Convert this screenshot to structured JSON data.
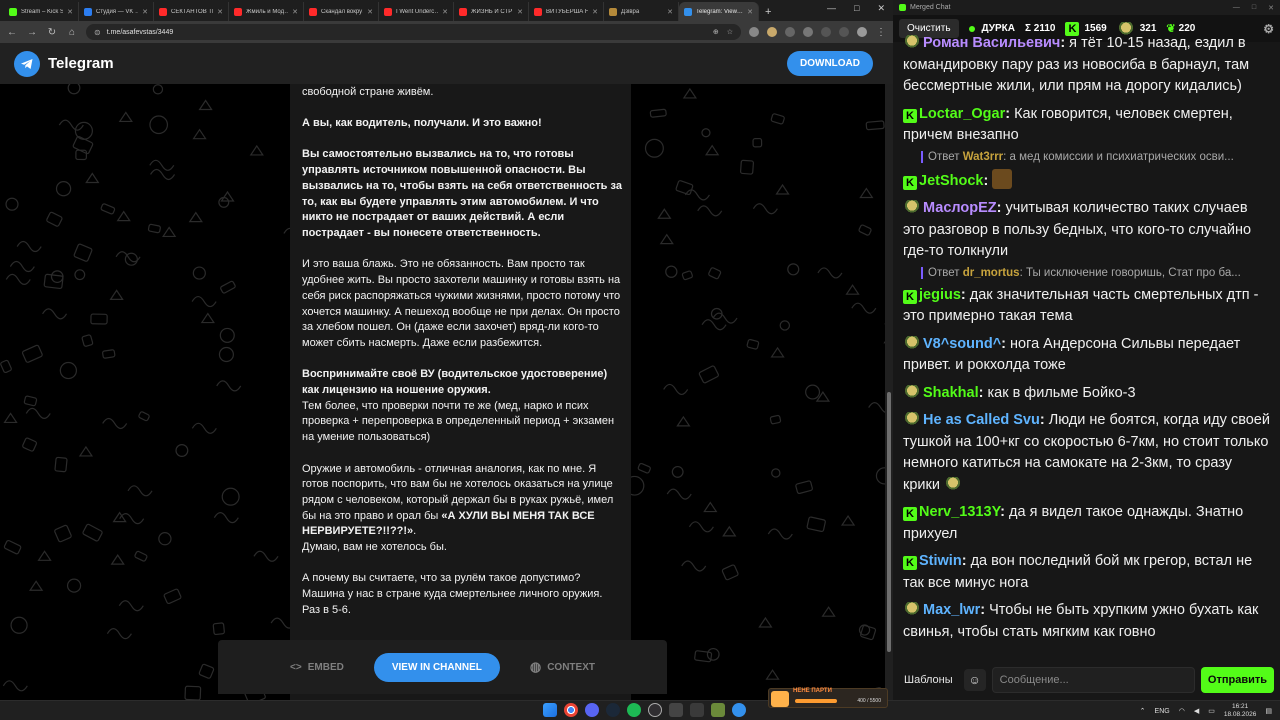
{
  "browser": {
    "tabs": [
      {
        "title": "Stream – Kick S…",
        "color": "#53fc18"
      },
      {
        "title": "Студия — VK …",
        "color": "#2c7df0"
      },
      {
        "title": "СЕКТАНТОВ ТЫ…",
        "color": "#ff2a2a"
      },
      {
        "title": "Жмиль и Мод…",
        "color": "#ff2a2a"
      },
      {
        "title": "Скандал вокру…",
        "color": "#ff2a2a"
      },
      {
        "title": "I Went Underc…",
        "color": "#ff2a2a"
      },
      {
        "title": "ЖИЗНЬ И СТР…",
        "color": "#ff2a2a"
      },
      {
        "title": "ВИТУБЕРША Н…",
        "color": "#ff2a2a"
      },
      {
        "title": "Дзівра",
        "color": "#b58a3a"
      },
      {
        "title": "Telegram: View…",
        "color": "#3390ec",
        "active": true
      }
    ],
    "new_tab": "+",
    "url": "t.me/asafevstas/3449"
  },
  "telegram": {
    "brand": "Telegram",
    "download": "DOWNLOAD",
    "post": {
      "paragraphs": [
        {
          "text": "улице? Нет. Это базовые правила и запрещения, но в свободной стране живём.",
          "bold": false
        },
        {
          "text": "А вы, как водитель, получали. И это важно!",
          "bold": true
        },
        {
          "text": "Вы самостоятельно вызвались на то, что готовы управлять источником повышенной опасности. Вы вызвались на то, чтобы взять на себя ответственность за то, как вы будете управлять этим автомобилем. И что никто не пострадает от ваших действий. А если пострадает - вы понесете ответственность.",
          "bold": true
        },
        {
          "text": "И это ваша блажь. Это не обязанность. Вам просто так удобнее жить. Вы просто захотели машинку и готовы взять на себя риск распоряжаться чужими жизнями, просто потому что хочется машинку. А пешеход вообще не при делах. Он просто за хлебом пошел. Он (даже если захочет) вряд-ли кого-то может сбить насмерть. Даже если разбежится.",
          "bold": false
        }
      ],
      "p5_bold": "Воспринимайте своё ВУ (водительское удостоверение) как лицензию на ношение оружия.",
      "p5_rest": "Тем более, что проверки почти те же (мед, нарко и псих проверка + перепроверка в определенный период + экзамен на умение пользоваться)",
      "p6_start": "Оружие и автомобиль - отличная аналогия, как по мне. Я готов поспорить, что вам бы не хотелось оказаться на улице рядом с человеком, который держал бы в руках ружьё, имел бы на это право и орал бы ",
      "p6_bold": "«А ХУЛИ ВЫ МЕНЯ ТАК ВСЕ НЕРВИРУЕТЕ?!!??!»",
      "p6_end": ".",
      "p6_line2": "Думаю, вам не хотелось бы.",
      "p7": "А почему вы считаете, что за рулём такое допустимо? Машина у нас в стране куда смертельнее личного оружия. Раз в 5-6."
    },
    "bottom": {
      "embed": "EMBED",
      "embed_icon": "<>",
      "view": "VIEW IN CHANNEL",
      "context": "CONTEXT"
    }
  },
  "chat": {
    "window_title": "Merged Chat",
    "clear": "Очистить",
    "channel": "ДУРКА",
    "sum": "Σ 2110",
    "kick_count": "1569",
    "second_count": "321",
    "third_count": "220",
    "accent": "#53fc18",
    "messages": [
      {
        "badge": "emote",
        "user": "Роман Васильевич",
        "color": "#b88cff",
        "text": " я тёт 10-15 назад, ездил в командировку пару раз из новосиба в барнаул, там бессмертные жили, или прям на дорогу кидались)"
      },
      {
        "badge": "kick",
        "user": "Loctar_Ogar",
        "color": "#53fc18",
        "text": " Как говорится, человек смертен, причем внезапно"
      },
      {
        "reply": true,
        "reply_label": "Ответ",
        "reply_user": "Wat3rrr",
        "reply_text": ": а мед комиссии и психиатрических осви..."
      },
      {
        "badge": "kick",
        "user": "JetShock",
        "color": "#53fc18",
        "text": " ",
        "bigemote": true
      },
      {
        "badge": "emote",
        "user": "МаслорEZ",
        "color": "#b88cff",
        "text": " учитывая количество таких случаев это разговор в пользу бедных, что кого-то случайно где-то толкнули"
      },
      {
        "reply": true,
        "reply_label": "Ответ",
        "reply_user": "dr_mortus",
        "reply_text": ": Ты исключение говоришь, Стат про ба..."
      },
      {
        "badge": "kick",
        "user": "jegius",
        "color": "#53fc18",
        "text": " дак значительная часть смертельных дтп - это примерно такая тема"
      },
      {
        "badge": "emote",
        "user": "V8^sound^",
        "color": "#5fb4ff",
        "text": " нога Андерсона Сильвы передает привет. и рокхолда тоже"
      },
      {
        "badge": "emote",
        "user": "Shakhal",
        "color": "#53fc18",
        "text": " как в фильме Бойко-3"
      },
      {
        "badge": "emote",
        "user": "He as Called Svu",
        "color": "#5fb4ff",
        "text": " Люди не боятся, когда иду своей тушкой на 100+кг со скоростью 6-7км, но стоит только немного катиться на самокате на 2-3км, то сразу крики ",
        "trail_emote": true
      },
      {
        "badge": "kick",
        "user": "Nerv_1313Y",
        "color": "#53fc18",
        "text": " да я видел такое однажды. Знатно прихуел"
      },
      {
        "badge": "kick",
        "user": "Stiwin",
        "color": "#5fb4ff",
        "text": " да вон последний бой мк грегор, встал не так все минус нога"
      },
      {
        "badge": "emote",
        "user": "Max_lwr",
        "color": "#5fb4ff",
        "text": " Чтобы не быть хрупким ужно бухать как свинья, чтобы стать мягким как говно"
      }
    ],
    "templates": "Шаблоны",
    "input_placeholder": "Сообщение...",
    "send": "Отправить"
  },
  "taskbar": {
    "overlay_title": "НЕНЕ ПАРТИ",
    "overlay_value": "400 / 5500",
    "overlay_progress": 0.07,
    "lang": "ENG",
    "time": "16:21",
    "date": "18.08.2026"
  }
}
